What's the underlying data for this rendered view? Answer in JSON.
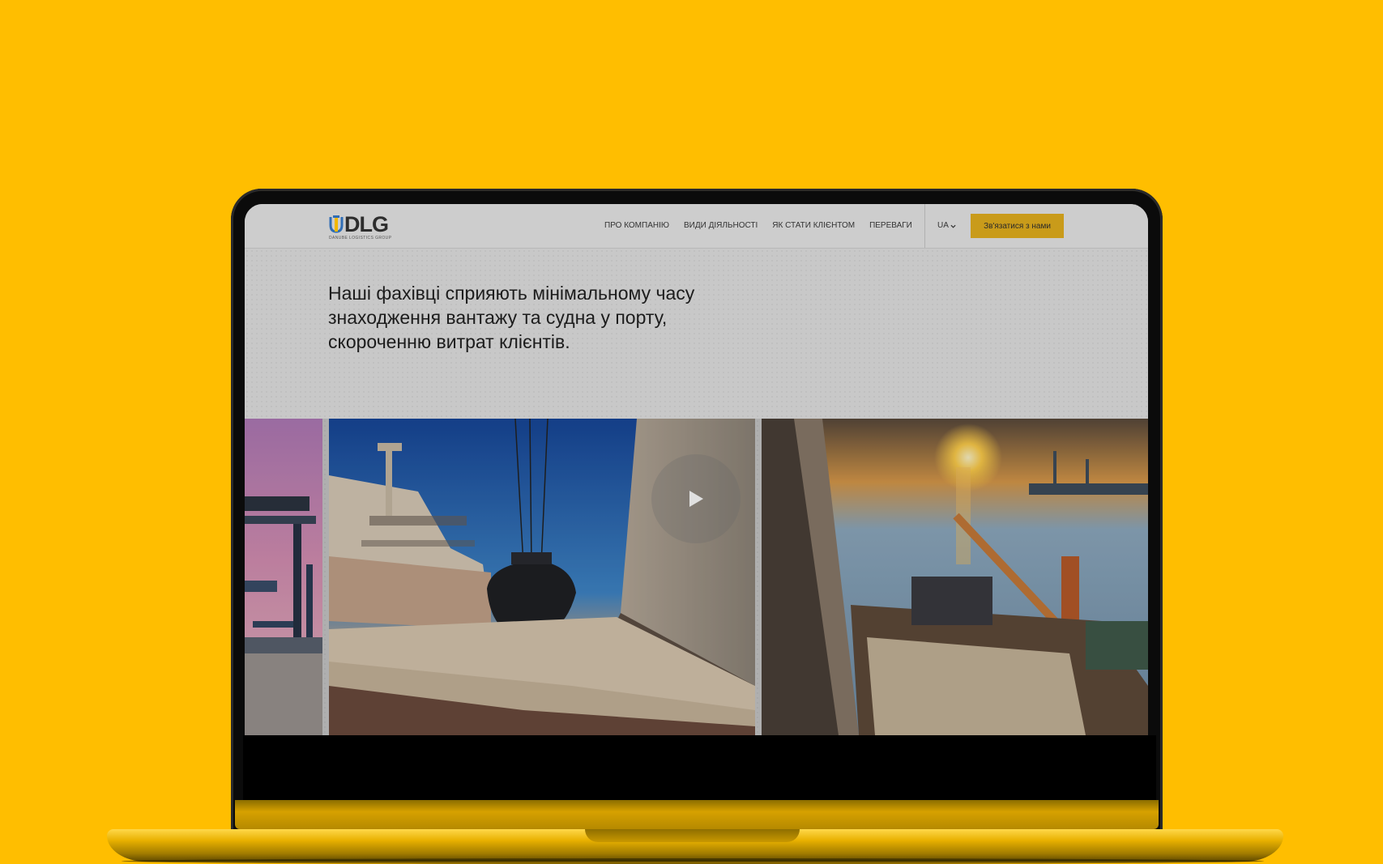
{
  "colors": {
    "page_background": "#FFBE00",
    "header_background": "#CDCDCD",
    "cta_background": "#C99B1A",
    "logo_accent_blue": "#2F6DB5",
    "logo_accent_yellow": "#F2B700"
  },
  "header": {
    "logo": {
      "text": "DLG",
      "tagline": "DANUBE LOGISTICS GROUP",
      "icon": "anchor-logo-icon"
    },
    "nav": [
      {
        "label": "ПРО КОМПАНІЮ"
      },
      {
        "label": "ВИДИ ДІЯЛЬНОСТІ"
      },
      {
        "label": "ЯК СТАТИ КЛІЄНТОМ"
      },
      {
        "label": "ПЕРЕВАГИ"
      }
    ],
    "language": {
      "selected": "UA",
      "icon": "chevron-down-icon"
    },
    "cta_label": "Зв'язатися з нами"
  },
  "hero": {
    "headline": "Наші фахівці сприяють мінімальному часу знаходження вантажу та судна у порту, скороченню витрат клієнтів."
  },
  "gallery": {
    "play_icon": "play-icon"
  }
}
